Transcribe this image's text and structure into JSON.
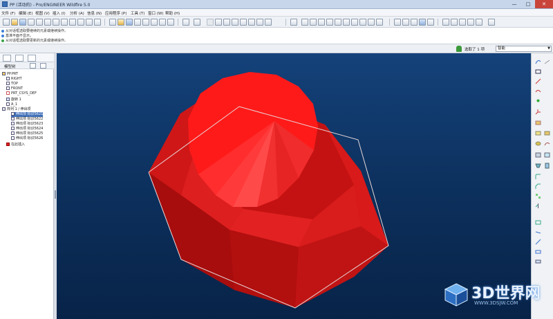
{
  "window": {
    "title": "PP (活动的) - Pro/ENGINEER Wildfire 5.0"
  },
  "menu": {
    "items": [
      "文件 (F)",
      "编辑 (E)",
      "视图 (V)",
      "插入 (I)",
      "分析 (A)",
      "信息 (N)",
      "应用程序 (P)",
      "工具 (T)",
      "窗口 (W)",
      "帮助 (H)"
    ]
  },
  "messages": [
    "从对话框选取要继续的元素或继续操作。",
    "基准平面不显示。",
    "从对话框选取要更新的元素或继续操作。"
  ],
  "status": {
    "selected": "选取了 1 项",
    "filter": "智能"
  },
  "navigator": {
    "title": "模型树"
  },
  "tree": {
    "items": [
      "PP.PRT",
      "RIGHT",
      "TOP",
      "FRONT",
      "PRT_CSYS_DEF",
      "旋转 1",
      "A_1",
      "阵列 1 / 伸出项",
      "伸出项 标识5621",
      "伸出项 标识5622",
      "伸出项 标识5623",
      "伸出项 标识5624",
      "伸出项 标识5625",
      "伸出项 标识5626",
      "在此插入"
    ]
  },
  "watermark": {
    "brand": "3D世界网",
    "url": "WWW.3DSJW.COM"
  },
  "colors": {
    "model": "#ff1a1a",
    "viewport": "#0c2f5b",
    "selection": "#3f6fb8"
  }
}
